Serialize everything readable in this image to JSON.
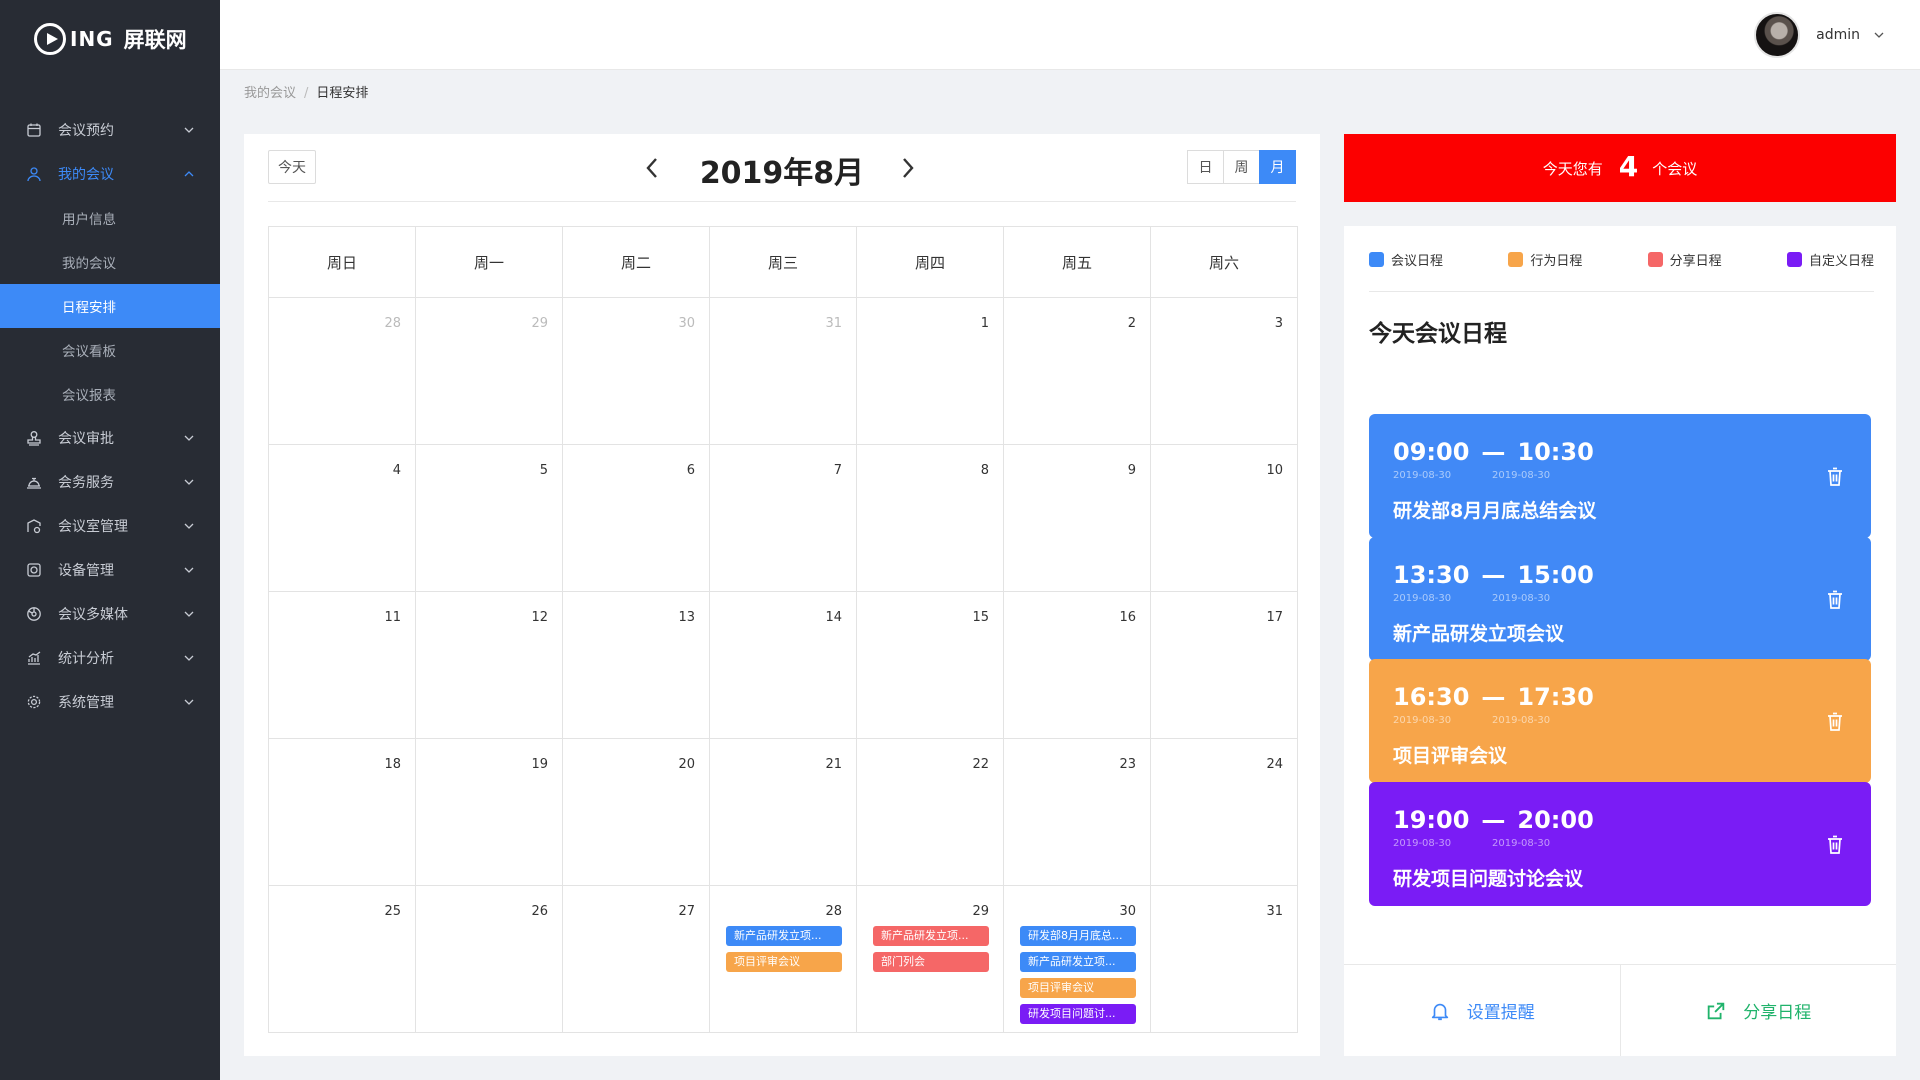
{
  "brand": {
    "mark": "ING",
    "name": "屏联网"
  },
  "sidebar": {
    "items": [
      {
        "label": "会议预约",
        "icon": "calendar-icon"
      },
      {
        "label": "我的会议",
        "icon": "user-icon",
        "open": true,
        "children": [
          {
            "label": "用户信息"
          },
          {
            "label": "我的会议"
          },
          {
            "label": "日程安排",
            "active": true
          },
          {
            "label": "会议看板"
          },
          {
            "label": "会议报表"
          }
        ]
      },
      {
        "label": "会议审批",
        "icon": "stamp-icon"
      },
      {
        "label": "会务服务",
        "icon": "service-icon"
      },
      {
        "label": "会议室管理",
        "icon": "room-icon"
      },
      {
        "label": "设备管理",
        "icon": "device-icon"
      },
      {
        "label": "会议多媒体",
        "icon": "media-icon"
      },
      {
        "label": "统计分析",
        "icon": "chart-icon"
      },
      {
        "label": "系统管理",
        "icon": "gear-icon"
      }
    ]
  },
  "header": {
    "user": "admin"
  },
  "breadcrumb": {
    "parent": "我的会议",
    "separator": "/",
    "current": "日程安排"
  },
  "calendar": {
    "today_label": "今天",
    "title": "2019年8月",
    "views": [
      "日",
      "周",
      "月"
    ],
    "active_view": "月",
    "weekdays": [
      "周日",
      "周一",
      "周二",
      "周三",
      "周四",
      "周五",
      "周六"
    ],
    "weeks": [
      [
        {
          "n": "28",
          "other": true
        },
        {
          "n": "29",
          "other": true
        },
        {
          "n": "30",
          "other": true
        },
        {
          "n": "31",
          "other": true
        },
        {
          "n": "1"
        },
        {
          "n": "2"
        },
        {
          "n": "3"
        }
      ],
      [
        {
          "n": "4"
        },
        {
          "n": "5"
        },
        {
          "n": "6"
        },
        {
          "n": "7"
        },
        {
          "n": "8"
        },
        {
          "n": "9"
        },
        {
          "n": "10"
        }
      ],
      [
        {
          "n": "11"
        },
        {
          "n": "12"
        },
        {
          "n": "13"
        },
        {
          "n": "14"
        },
        {
          "n": "15"
        },
        {
          "n": "16"
        },
        {
          "n": "17"
        }
      ],
      [
        {
          "n": "18"
        },
        {
          "n": "19"
        },
        {
          "n": "20"
        },
        {
          "n": "21"
        },
        {
          "n": "22"
        },
        {
          "n": "23"
        },
        {
          "n": "24"
        }
      ],
      [
        {
          "n": "25"
        },
        {
          "n": "26"
        },
        {
          "n": "27"
        },
        {
          "n": "28",
          "events": [
            {
              "text": "新产品研发立项...",
              "color": "blue"
            },
            {
              "text": "项目评审会议",
              "color": "orange"
            }
          ]
        },
        {
          "n": "29",
          "events": [
            {
              "text": "新产品研发立项...",
              "color": "red"
            },
            {
              "text": "部门列会",
              "color": "red"
            }
          ]
        },
        {
          "n": "30",
          "events": [
            {
              "text": "研发部8月月底总...",
              "color": "blue"
            },
            {
              "text": "新产品研发立项...",
              "color": "blue"
            },
            {
              "text": "项目评审会议",
              "color": "orange"
            },
            {
              "text": "研发项目问题讨...",
              "color": "purple"
            }
          ]
        },
        {
          "n": "31"
        }
      ]
    ]
  },
  "banner": {
    "prefix": "今天您有",
    "count": "4",
    "suffix": "个会议",
    "color": "#fc0000"
  },
  "legend": [
    {
      "label": "会议日程",
      "color": "#3d8af7"
    },
    {
      "label": "行为日程",
      "color": "#f7a54a"
    },
    {
      "label": "分享日程",
      "color": "#f56767"
    },
    {
      "label": "自定义日程",
      "color": "#7a1cf5"
    }
  ],
  "today_title": "今天会议日程",
  "meetings": [
    {
      "start": "09:00",
      "end": "10:30",
      "start_date": "2019-08-30",
      "end_date": "2019-08-30",
      "title": "研发部8月月底总结会议",
      "color": "blue"
    },
    {
      "start": "13:30",
      "end": "15:00",
      "start_date": "2019-08-30",
      "end_date": "2019-08-30",
      "title": "新产品研发立项会议",
      "color": "blue"
    },
    {
      "start": "16:30",
      "end": "17:30",
      "start_date": "2019-08-30",
      "end_date": "2019-08-30",
      "title": "项目评审会议",
      "color": "orange"
    },
    {
      "start": "19:00",
      "end": "20:00",
      "start_date": "2019-08-30",
      "end_date": "2019-08-30",
      "title": "研发项目问题讨论会议",
      "color": "purple"
    }
  ],
  "time_dash": "—",
  "actions": {
    "remind": "设置提醒",
    "share": "分享日程"
  }
}
